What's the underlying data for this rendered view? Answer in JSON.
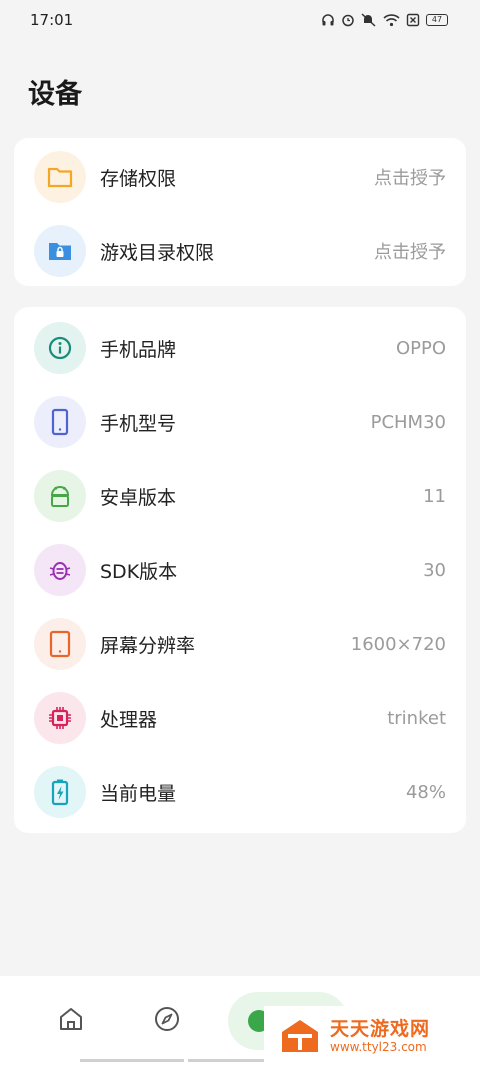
{
  "status_bar": {
    "time": "17:01",
    "battery": "47",
    "icons": [
      "headset-icon",
      "alarm-icon",
      "mute-icon",
      "wifi-icon",
      "no-sim-icon",
      "battery-icon"
    ]
  },
  "page": {
    "title": "设备"
  },
  "permissions": [
    {
      "label": "存储权限",
      "value": "点击授予",
      "icon": "folder-icon",
      "color": "#f5a623",
      "bg": "#fdf2e2"
    },
    {
      "label": "游戏目录权限",
      "value": "点击授予",
      "icon": "folder-lock-icon",
      "color": "#3b8fe0",
      "bg": "#e6f1fc"
    }
  ],
  "device_info": [
    {
      "label": "手机品牌",
      "value": "OPPO",
      "icon": "info-icon",
      "color": "#1a8b7a",
      "bg": "#e3f3f0"
    },
    {
      "label": "手机型号",
      "value": "PCHM30",
      "icon": "phone-icon",
      "color": "#4f63d2",
      "bg": "#eceffb"
    },
    {
      "label": "安卓版本",
      "value": "11",
      "icon": "android-icon",
      "color": "#45a845",
      "bg": "#e7f5e7"
    },
    {
      "label": "SDK版本",
      "value": "30",
      "icon": "bug-icon",
      "color": "#9a2fb2",
      "bg": "#f4e6f7"
    },
    {
      "label": "屏幕分辨率",
      "value": "1600×720",
      "icon": "tablet-icon",
      "color": "#e8662b",
      "bg": "#fceee8"
    },
    {
      "label": "处理器",
      "value": "trinket",
      "icon": "chip-icon",
      "color": "#d8235a",
      "bg": "#fbe6ec"
    },
    {
      "label": "当前电量",
      "value": "48%",
      "icon": "battery-charging-icon",
      "color": "#17a3b8",
      "bg": "#e2f5f7"
    }
  ],
  "bottom_nav": {
    "items": [
      "home-icon",
      "compass-icon",
      "device-icon"
    ],
    "active": "device-icon",
    "accent": "#3aa84a"
  },
  "watermark": {
    "title": "天天游戏网",
    "url": "www.ttyl23.com"
  }
}
